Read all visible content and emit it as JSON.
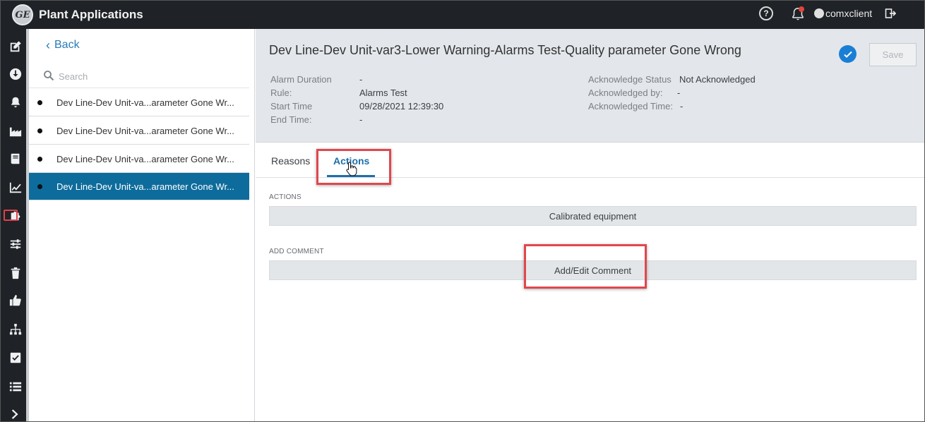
{
  "app": {
    "title": "Plant Applications",
    "logo_text": "GE",
    "username": "comxclient",
    "help_glyph": "?",
    "colors": {
      "accent": "#0e6c9c",
      "link": "#2a7bb7",
      "highlight": "#e0474d",
      "topbar": "#1f2226"
    }
  },
  "rail": {
    "icons": [
      "edit-icon",
      "download-circle-icon",
      "bell-icon",
      "factory-icon",
      "book-icon",
      "trend-chart-icon",
      "puzzle-icon",
      "sliders-icon",
      "trash-icon",
      "thumbs-up-icon",
      "hierarchy-icon",
      "checkbox-icon",
      "list-icon",
      "chevron-right-icon"
    ]
  },
  "list": {
    "back_label": "Back",
    "search_placeholder": "Search",
    "items": [
      {
        "label": "Dev Line-Dev Unit-va...arameter Gone Wr...",
        "selected": false
      },
      {
        "label": "Dev Line-Dev Unit-va...arameter Gone Wr...",
        "selected": false
      },
      {
        "label": "Dev Line-Dev Unit-va...arameter Gone Wr...",
        "selected": false
      },
      {
        "label": "Dev Line-Dev Unit-va...arameter Gone Wr...",
        "selected": true
      }
    ]
  },
  "detail": {
    "title": "Dev Line-Dev Unit-var3-Lower Warning-Alarms Test-Quality parameter Gone Wrong",
    "save_label": "Save",
    "meta_left": [
      {
        "label": "Alarm Duration",
        "value": "-"
      },
      {
        "label": "Rule:",
        "value": "Alarms Test"
      },
      {
        "label": "Start Time",
        "value": "09/28/2021 12:39:30"
      },
      {
        "label": "End Time:",
        "value": "-"
      }
    ],
    "meta_right": [
      {
        "label": "Acknowledge Status",
        "value": "Not Acknowledged"
      },
      {
        "label": "Acknowledged by:",
        "value": "-"
      },
      {
        "label": "Acknowledged Time:",
        "value": "-"
      }
    ],
    "tabs": [
      {
        "label": "Reasons",
        "active": false
      },
      {
        "label": "Actions",
        "active": true
      }
    ],
    "actions_section_label": "ACTIONS",
    "action_value": "Calibrated equipment",
    "comment_section_label": "ADD COMMENT",
    "comment_button_label": "Add/Edit Comment"
  }
}
